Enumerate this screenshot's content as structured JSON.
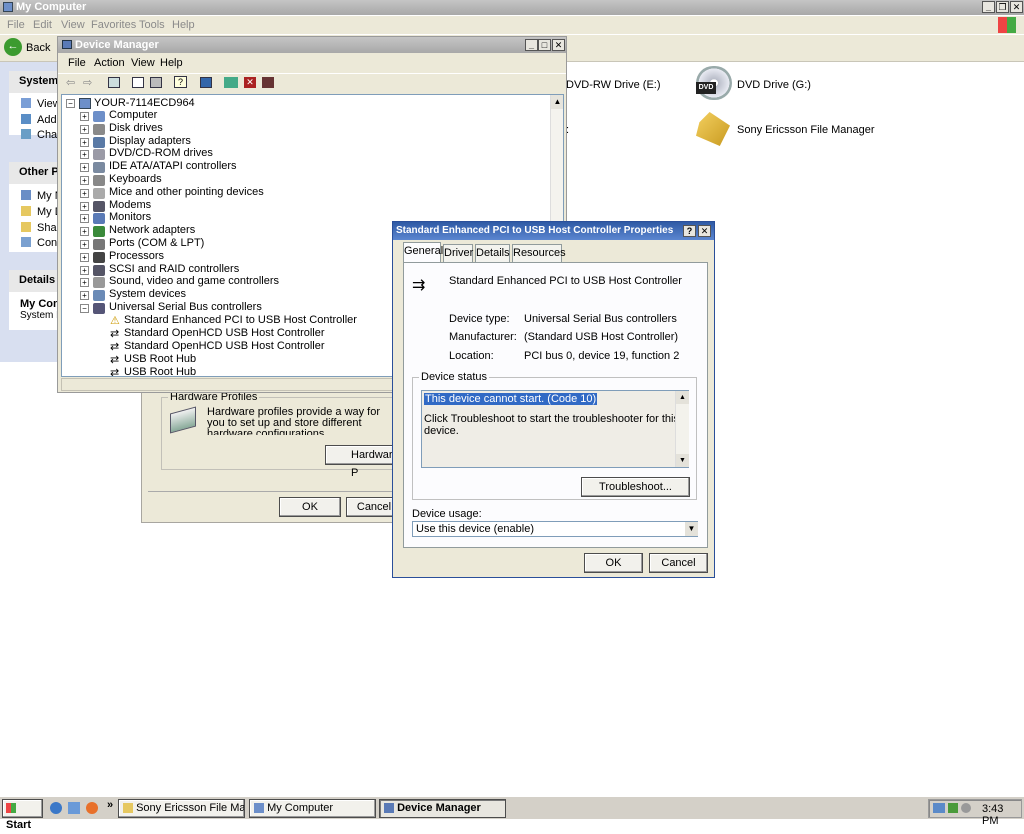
{
  "my_computer": {
    "title": "My Computer",
    "menu": [
      "File",
      "Edit",
      "View",
      "Favorites",
      "Tools",
      "Help"
    ],
    "back_label": "Back",
    "panel_system": "System",
    "system_links": [
      "View",
      "Add",
      "Char"
    ],
    "panel_other": "Other Pl",
    "other_links": [
      "My N",
      "My D",
      "Shar",
      "Cont"
    ],
    "panel_details": "Details",
    "details_title": "My Com",
    "details_sub": "System F",
    "drive_e": "DVD-RW Drive (E:)",
    "drive_g": "DVD Drive (G:)",
    "sony": "Sony Ericsson File Manager"
  },
  "system_props": {
    "group_label": "Hardware Profiles",
    "desc": "Hardware profiles provide a way for you to set up and store different hardware configurations.",
    "hw_button": "Hardware P",
    "ok": "OK",
    "cancel": "Cancel"
  },
  "device_manager": {
    "title": "Device Manager",
    "menu": [
      "File",
      "Action",
      "View",
      "Help"
    ],
    "root": "YOUR-7114ECD964",
    "categories": [
      "Computer",
      "Disk drives",
      "Display adapters",
      "DVD/CD-ROM drives",
      "IDE ATA/ATAPI controllers",
      "Keyboards",
      "Mice and other pointing devices",
      "Modems",
      "Monitors",
      "Network adapters",
      "Ports (COM & LPT)",
      "Processors",
      "SCSI and RAID controllers",
      "Sound, video and game controllers",
      "System devices",
      "Universal Serial Bus controllers"
    ],
    "usb_children": [
      "Standard Enhanced PCI to USB Host Controller",
      "Standard OpenHCD USB Host Controller",
      "Standard OpenHCD USB Host Controller",
      "USB Root Hub",
      "USB Root Hub"
    ]
  },
  "props_dialog": {
    "title": "Standard Enhanced PCI to USB Host Controller Properties",
    "tabs": [
      "General",
      "Driver",
      "Details",
      "Resources"
    ],
    "device_name": "Standard Enhanced PCI to USB Host Controller",
    "type_label": "Device type:",
    "type_value": "Universal Serial Bus controllers",
    "mfr_label": "Manufacturer:",
    "mfr_value": "(Standard USB Host Controller)",
    "loc_label": "Location:",
    "loc_value": "PCI bus 0, device 19, function 2",
    "status_group": "Device status",
    "status_line1": "This device cannot start. (Code 10)",
    "status_line2": "Click Troubleshoot to start the troubleshooter for this device.",
    "troubleshoot": "Troubleshoot...",
    "usage_label": "Device usage:",
    "usage_value": "Use this device (enable)",
    "ok": "OK",
    "cancel": "Cancel"
  },
  "taskbar": {
    "start": "Start",
    "chevron": "»",
    "tasks": [
      "Sony Ericsson File Manager",
      "My Computer",
      "Device Manager"
    ],
    "clock": "3:43 PM"
  }
}
